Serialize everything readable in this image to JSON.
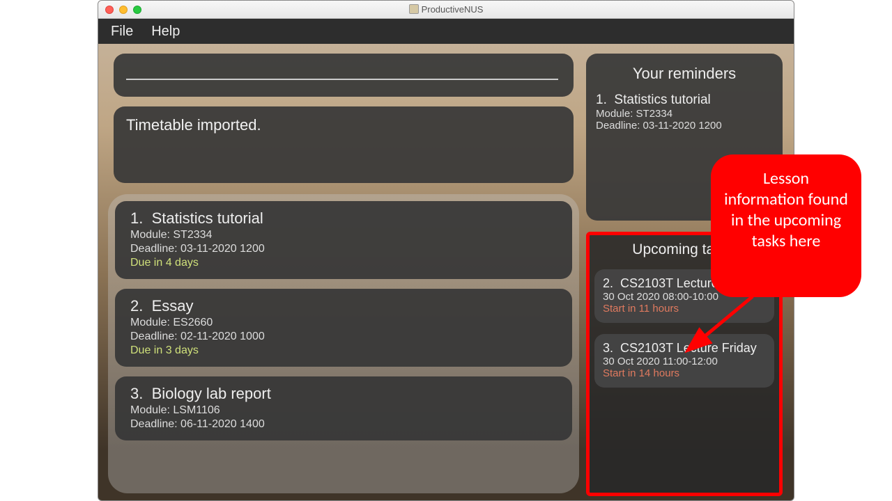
{
  "window": {
    "title": "ProductiveNUS",
    "menu": {
      "file": "File",
      "help": "Help"
    }
  },
  "status": {
    "message": "Timetable imported."
  },
  "tasks": [
    {
      "index": "1.",
      "title": "Statistics tutorial",
      "module": "Module: ST2334",
      "deadline": "Deadline: 03-11-2020 1200",
      "due": "Due in 4 days"
    },
    {
      "index": "2.",
      "title": "Essay",
      "module": "Module: ES2660",
      "deadline": "Deadline: 02-11-2020 1000",
      "due": "Due in 3 days"
    },
    {
      "index": "3.",
      "title": "Biology lab report",
      "module": "Module: LSM1106",
      "deadline": "Deadline: 06-11-2020 1400",
      "due": ""
    }
  ],
  "reminders": {
    "heading": "Your reminders",
    "items": [
      {
        "index": "1.",
        "title": "Statistics tutorial",
        "module": "Module: ST2334",
        "deadline": "Deadline: 03-11-2020 1200"
      }
    ]
  },
  "upcoming": {
    "heading": "Upcoming tasks",
    "items": [
      {
        "index": "2.",
        "title": "CS2103T Lecture Friday",
        "time": "30 Oct 2020 08:00-10:00",
        "start": "Start in 11 hours"
      },
      {
        "index": "3.",
        "title": "CS2103T Lecture Friday",
        "time": "30 Oct 2020 11:00-12:00",
        "start": "Start in 14 hours"
      }
    ]
  },
  "annotation": {
    "text": "Lesson information found in the upcoming tasks here"
  }
}
